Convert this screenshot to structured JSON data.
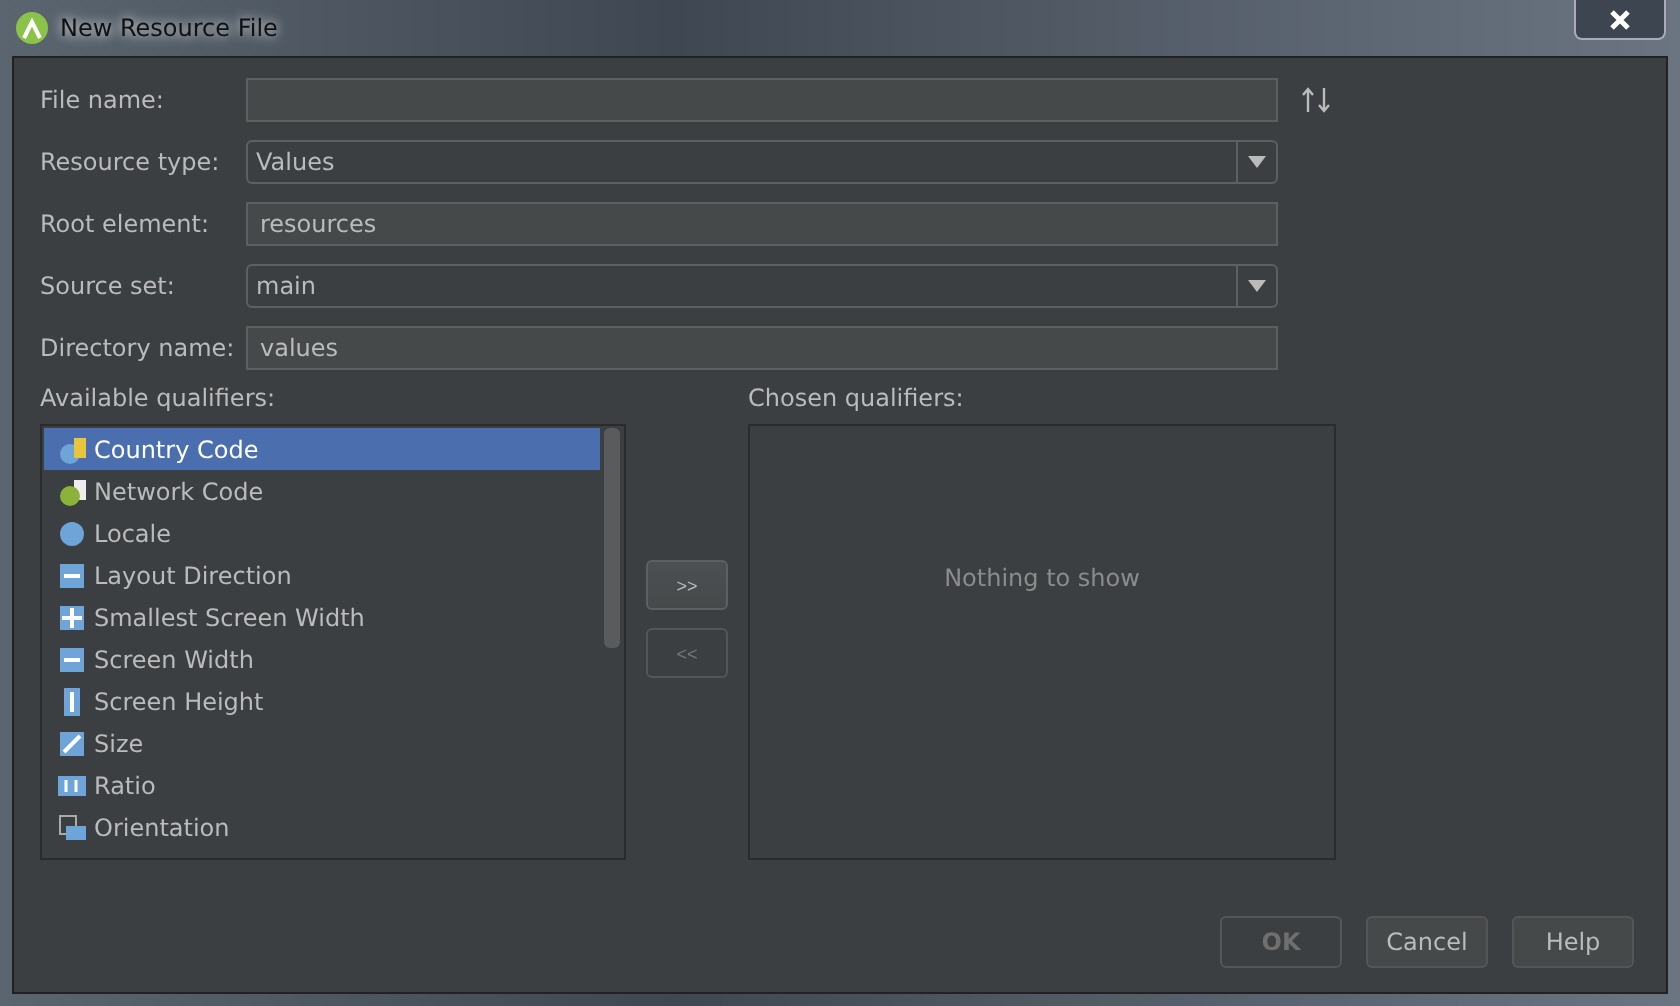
{
  "window": {
    "title": "New Resource File"
  },
  "fields": [
    {
      "kind": "text",
      "label": "File name:"
    },
    {
      "kind": "combo",
      "label": "Resource type:",
      "value": "Values"
    },
    {
      "kind": "readonly",
      "label": "Root element:",
      "value": "resources"
    },
    {
      "kind": "combo",
      "label": "Source set:",
      "value": "main"
    },
    {
      "kind": "readonly",
      "label": "Directory name:",
      "value": "values"
    }
  ],
  "available": {
    "label": "Available qualifiers:",
    "items": [
      {
        "label": "Country Code",
        "selected": true
      },
      {
        "label": "Network Code",
        "selected": false
      },
      {
        "label": "Locale",
        "selected": false
      },
      {
        "label": "Layout Direction",
        "selected": false
      },
      {
        "label": "Smallest Screen Width",
        "selected": false
      },
      {
        "label": "Screen Width",
        "selected": false
      },
      {
        "label": "Screen Height",
        "selected": false
      },
      {
        "label": "Size",
        "selected": false
      },
      {
        "label": "Ratio",
        "selected": false
      },
      {
        "label": "Orientation",
        "selected": false
      }
    ]
  },
  "move_buttons": [
    {
      "label": ">>",
      "disabled": false
    },
    {
      "label": "<<",
      "disabled": true
    }
  ],
  "chosen": {
    "label": "Chosen qualifiers:",
    "empty_text": "Nothing to show"
  },
  "buttons": [
    {
      "label": "OK",
      "disabled": true
    },
    {
      "label": "Cancel",
      "disabled": false
    },
    {
      "label": "Help",
      "disabled": false
    }
  ]
}
